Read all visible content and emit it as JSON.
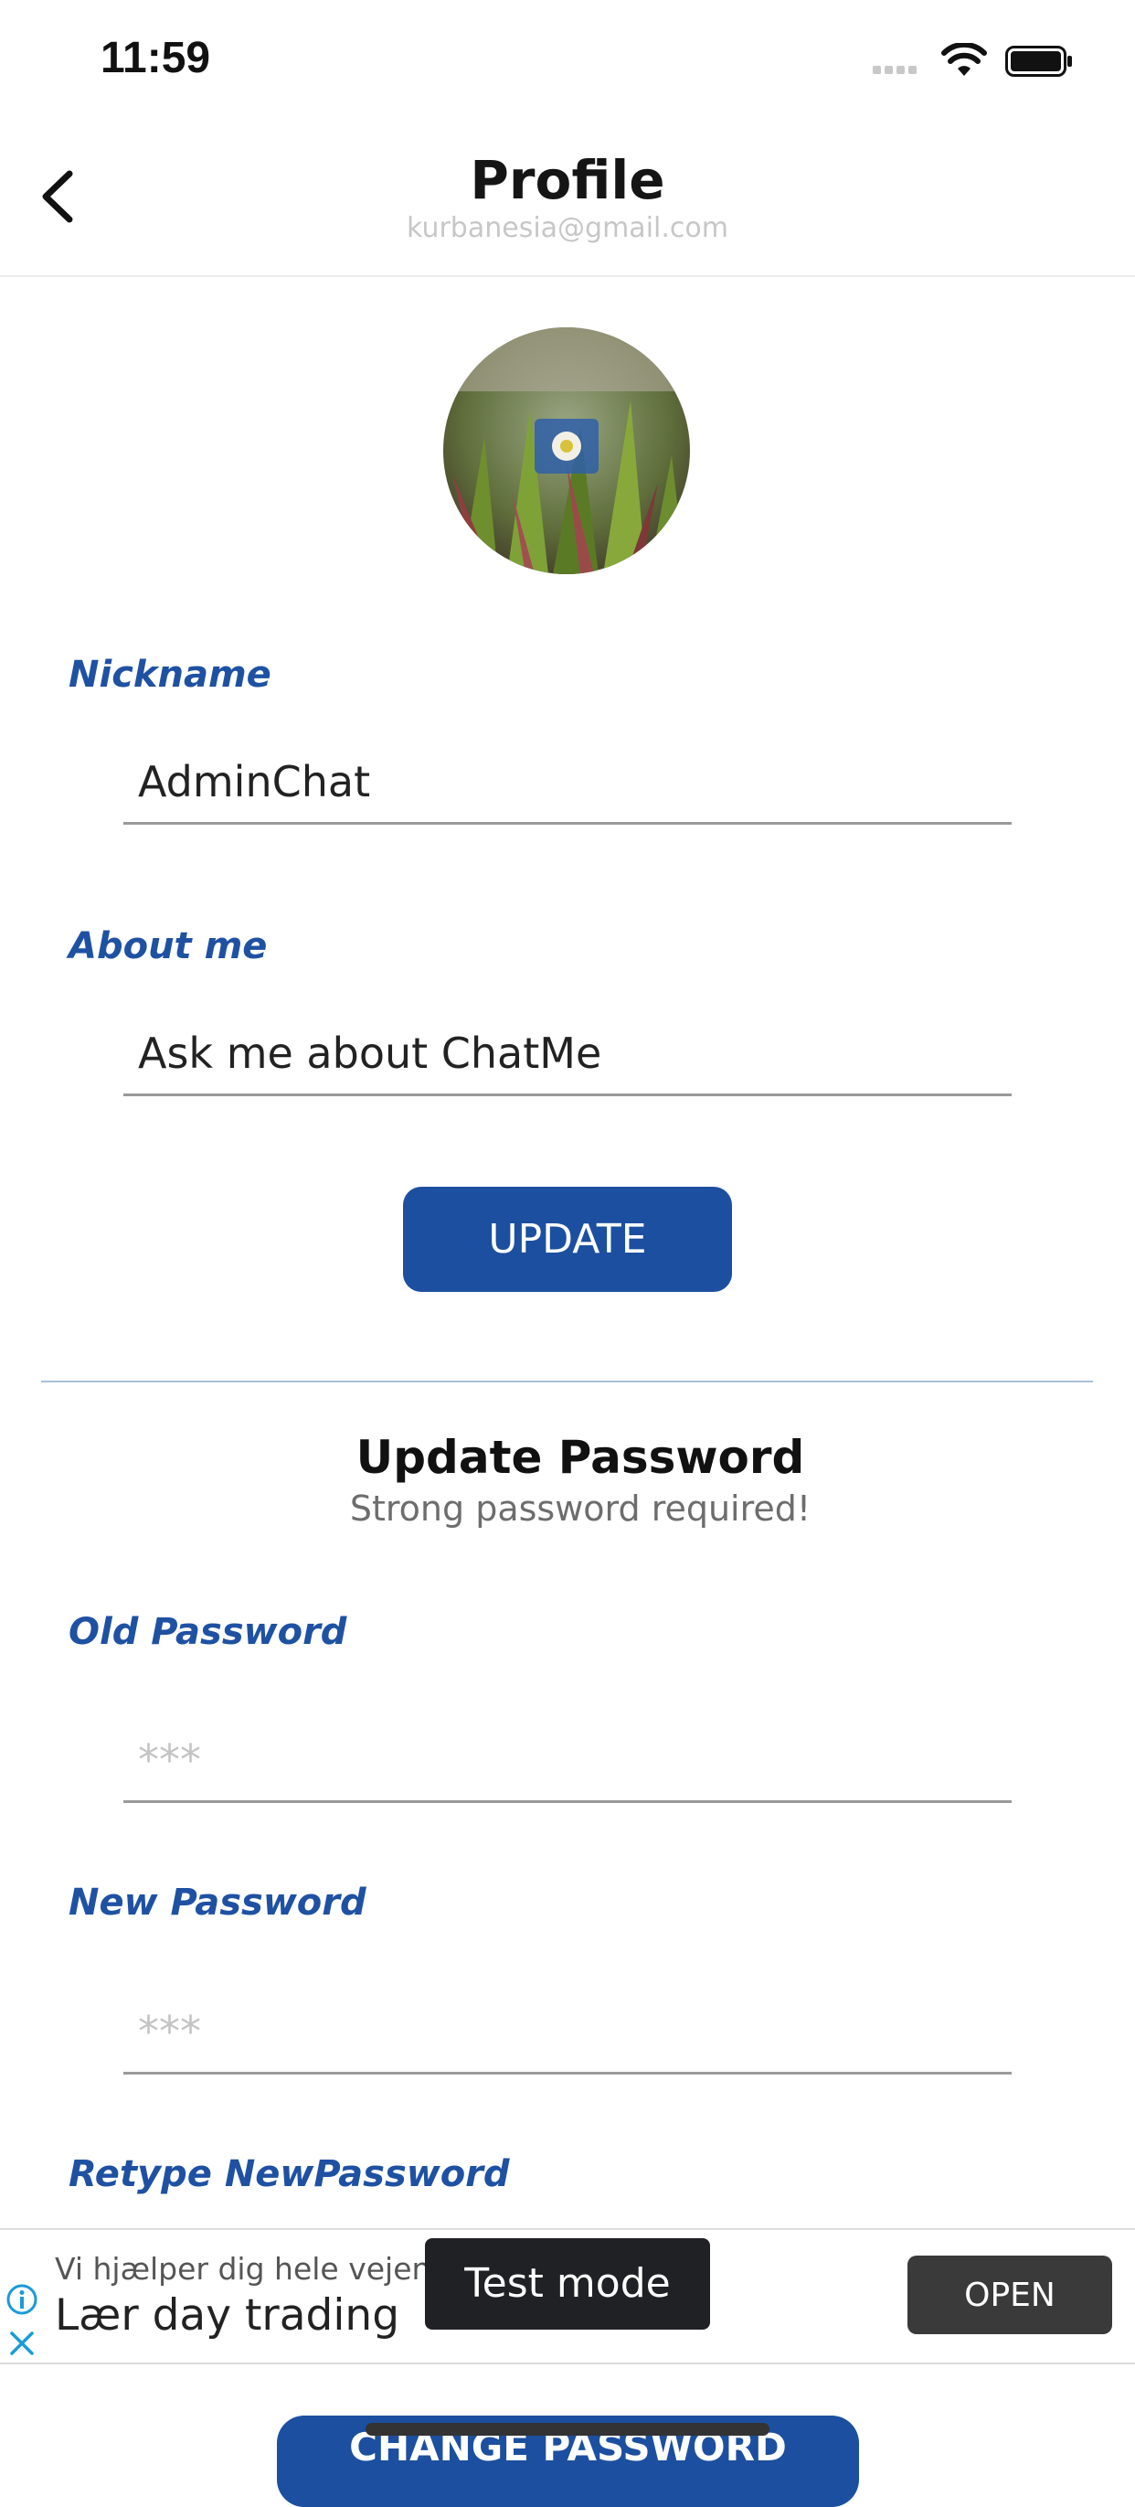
{
  "status_bar": {
    "time": "11:59"
  },
  "header": {
    "title": "Profile",
    "email": "kurbanesia@gmail.com"
  },
  "profile": {
    "nickname_label": "Nickname",
    "nickname_value": "AdminChat",
    "about_label": "About me",
    "about_value": "Ask me about ChatMe",
    "update_button": "UPDATE"
  },
  "password_section": {
    "title": "Update Password",
    "subtitle": "Strong password required!",
    "old_label": "Old Password",
    "old_placeholder": "***",
    "new_label": "New Password",
    "new_placeholder": "***",
    "retype_label": "Retype NewPassword",
    "change_button": "CHANGE PASSWORD"
  },
  "ad": {
    "line1": "Vi hjælper dig hele vejen",
    "line2": "Lær day trading",
    "test_mode": "Test mode",
    "open_button": "OPEN"
  },
  "colors": {
    "accent": "#1c4f9f",
    "label": "#1f51a3",
    "divider": "#a9c0d6"
  }
}
